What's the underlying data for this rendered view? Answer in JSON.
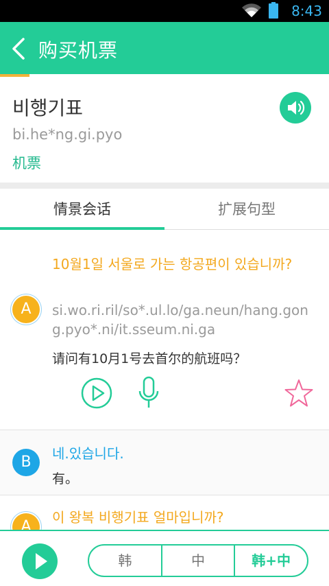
{
  "status_bar": {
    "time": "8:43"
  },
  "app_bar": {
    "title": "购买机票",
    "progress": 0.09
  },
  "word": {
    "korean": "비행기표",
    "romanization": "bi.he*ng.gi.pyo",
    "chinese": "机票"
  },
  "tabs": [
    {
      "label": "情景会话",
      "active": true
    },
    {
      "label": "扩展句型",
      "active": false
    }
  ],
  "dialogs": [
    {
      "speaker": "A",
      "korean": "10월1일 서울로 가는 항공편이 있습니까?",
      "romanization": "si.wo.ri.ril/so*.ul.lo/ga.neun/hang.gong.pyo*.ni/it.sseum.ni.ga",
      "chinese": "请问有10月1号去首尔的航班吗？"
    },
    {
      "speaker": "B",
      "korean": "네.있습니다.",
      "chinese": "有。"
    },
    {
      "speaker": "A",
      "korean": "이 왕복 비행기표 얼마입니까?"
    }
  ],
  "bottom_bar": {
    "modes": [
      "韩",
      "中",
      "韩+中"
    ],
    "selected_mode": "韩+中"
  },
  "colors": {
    "accent": "#23cc97",
    "speaker_a": "#f7b21c",
    "speaker_b": "#1ea6e6",
    "star": "#f0679a"
  },
  "icons": [
    "wifi-icon",
    "battery-icon",
    "back-icon",
    "speaker-icon",
    "play-icon",
    "microphone-icon",
    "star-icon"
  ]
}
